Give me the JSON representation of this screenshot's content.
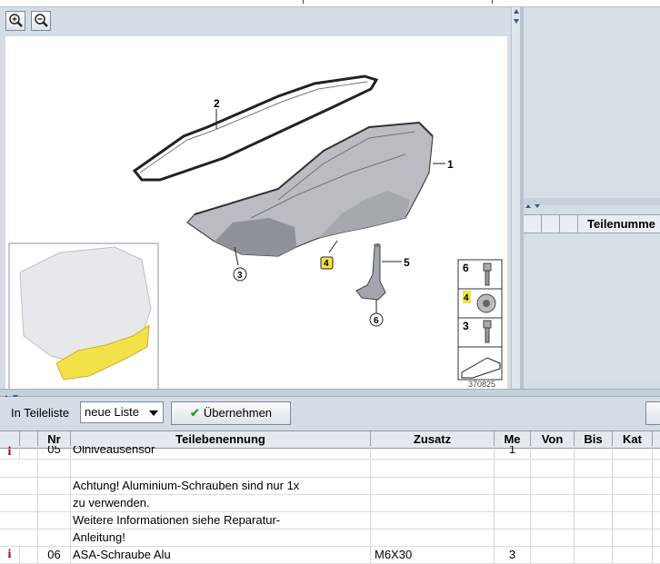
{
  "toolbar": {
    "parts_list_label": "In Teileliste",
    "list_select_value": "neue Liste",
    "apply_button_label": "Übernehmen"
  },
  "drawing": {
    "callouts": [
      "1",
      "2",
      "3",
      "4",
      "5",
      "6"
    ],
    "legend_items": [
      "6",
      "4",
      "3"
    ],
    "image_number": "370825"
  },
  "right_table": {
    "column_label": "Teilenumme"
  },
  "parts_table": {
    "headers": [
      "Nr",
      "Teilebenennung",
      "Zusatz",
      "Me",
      "Von",
      "Bis",
      "Kat"
    ],
    "rows": [
      {
        "info": "i",
        "nr": "05",
        "name": "Ölniveausensor",
        "zusatz": "",
        "me": "1"
      },
      {
        "info": "",
        "nr": "",
        "name": "",
        "zusatz": "",
        "me": ""
      },
      {
        "info": "",
        "nr": "",
        "name": "Achtung! Aluminium-Schrauben sind nur 1x",
        "zusatz": "",
        "me": ""
      },
      {
        "info": "",
        "nr": "",
        "name": "zu verwenden.",
        "zusatz": "",
        "me": ""
      },
      {
        "info": "",
        "nr": "",
        "name": "Weitere Informationen siehe Reparatur-",
        "zusatz": "",
        "me": ""
      },
      {
        "info": "",
        "nr": "",
        "name": "Anleitung!",
        "zusatz": "",
        "me": ""
      },
      {
        "info": "i",
        "nr": "06",
        "name": "ASA-Schraube Alu",
        "zusatz": "M6X30",
        "me": "3"
      }
    ]
  },
  "colors": {
    "accent_yellow": "#f3e14a",
    "info_red": "#b00000",
    "check_green": "#2aa52a"
  }
}
